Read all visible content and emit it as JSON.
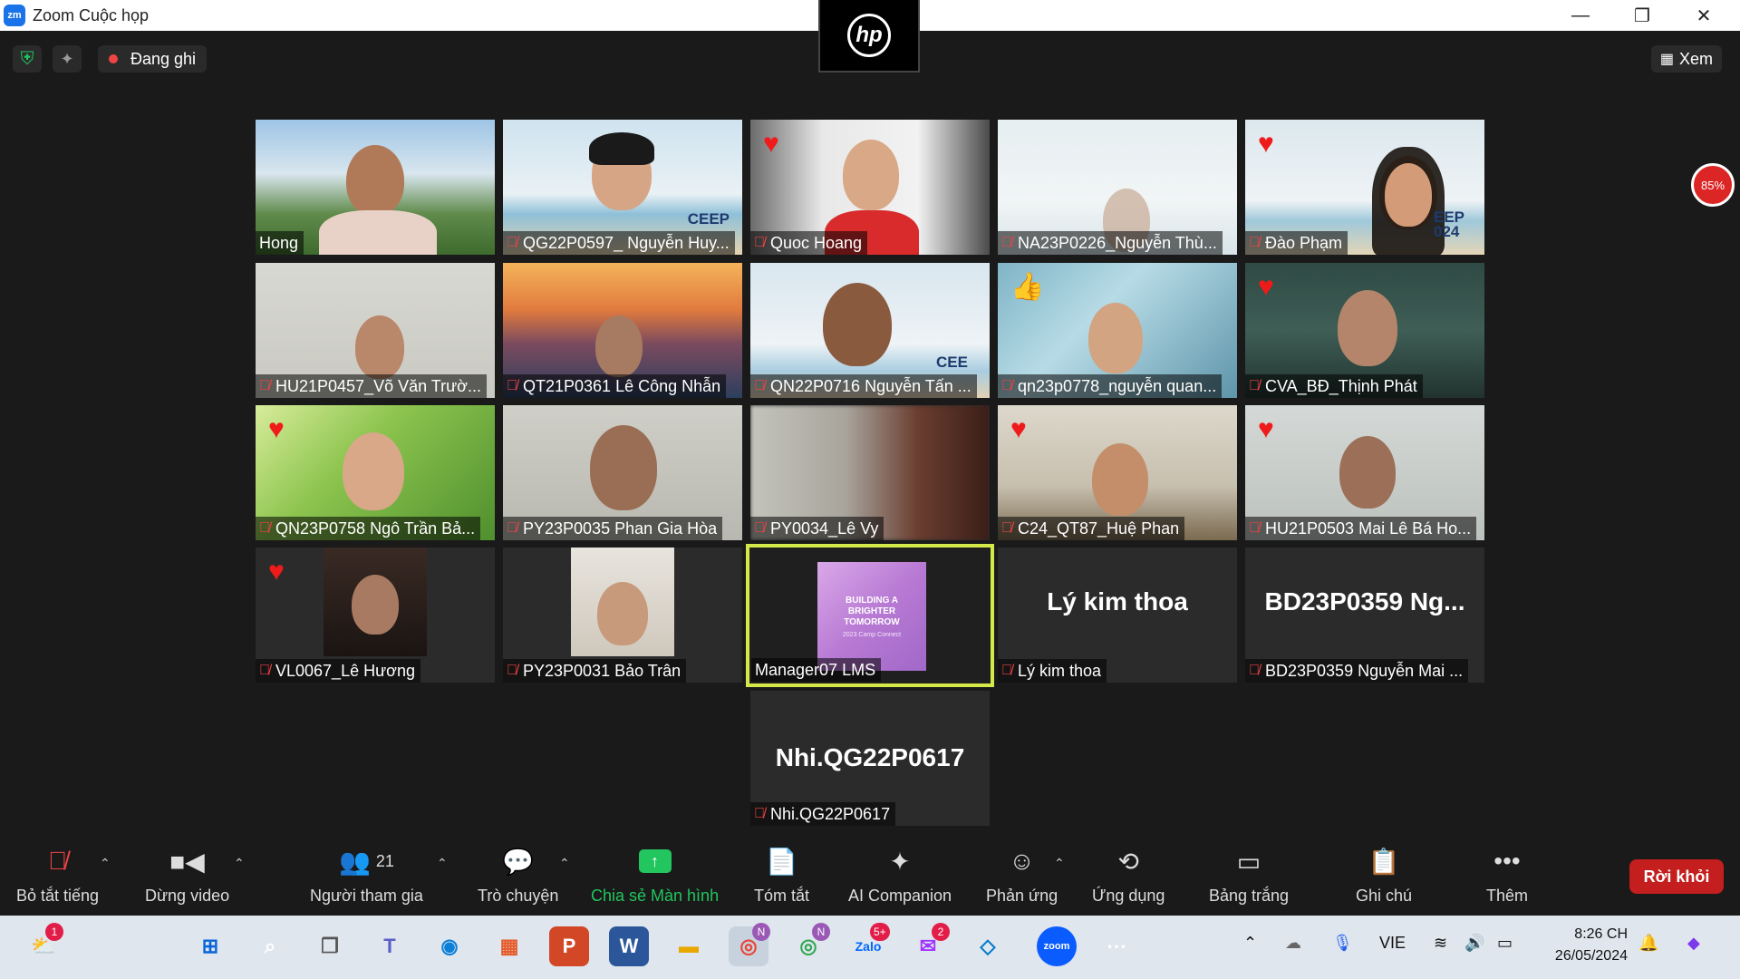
{
  "window": {
    "title": "Zoom Cuộc họp",
    "app_icon": "zm"
  },
  "topbar": {
    "recording_label": "Đang ghi",
    "view_label": "Xem",
    "cam_brand": "hp",
    "percent": "85%"
  },
  "tiles": [
    {
      "name": "Hong",
      "muted": false,
      "reaction": ""
    },
    {
      "name": "QG22P0597_ Nguyễn Huy...",
      "muted": true,
      "reaction": "",
      "overlay": "CEEP"
    },
    {
      "name": "Quoc Hoang",
      "muted": true,
      "reaction": "heart"
    },
    {
      "name": "NA23P0226_Nguyễn Thù...",
      "muted": true,
      "reaction": ""
    },
    {
      "name": "Đào Phạm",
      "muted": true,
      "reaction": "heart",
      "overlay": "EEP 024"
    },
    {
      "name": "HU21P0457_Võ Văn Trườ...",
      "muted": true,
      "reaction": ""
    },
    {
      "name": "QT21P0361 Lê Công Nhẫn",
      "muted": true,
      "reaction": ""
    },
    {
      "name": "QN22P0716 Nguyễn Tấn ...",
      "muted": true,
      "reaction": "",
      "overlay": "CEE"
    },
    {
      "name": "qn23p0778_nguyễn quan...",
      "muted": true,
      "reaction": "thumbs-up"
    },
    {
      "name": "CVA_BĐ_Thịnh Phát",
      "muted": true,
      "reaction": "heart"
    },
    {
      "name": "QN23P0758 Ngô Trần Bả...",
      "muted": true,
      "reaction": "heart"
    },
    {
      "name": "PY23P0035 Phan Gia Hòa",
      "muted": true,
      "reaction": ""
    },
    {
      "name": "PY0034_Lê Vy",
      "muted": true,
      "reaction": ""
    },
    {
      "name": "C24_QT87_Huệ Phan",
      "muted": true,
      "reaction": "heart"
    },
    {
      "name": "HU21P0503 Mai Lê Bá Ho...",
      "muted": true,
      "reaction": "heart"
    },
    {
      "name": "VL0067_Lê Hương",
      "muted": true,
      "reaction": "heart"
    },
    {
      "name": "PY23P0031 Bảo Trân",
      "muted": true,
      "reaction": ""
    },
    {
      "name": "Manager07 LMS",
      "muted": false,
      "reaction": "",
      "active": true,
      "slide_text": "BUILDING A BRIGHTER TOMORROW",
      "slide_sub": "2023 Camp Connect"
    },
    {
      "name": "Lý kim thoa",
      "muted": true,
      "reaction": "",
      "big_name": "Lý kim thoa"
    },
    {
      "name": "BD23P0359 Nguyễn Mai ...",
      "muted": true,
      "reaction": "",
      "big_name": "BD23P0359  Ng..."
    },
    {
      "name": "Nhi.QG22P0617",
      "muted": true,
      "reaction": "",
      "big_name": "Nhi.QG22P0617"
    }
  ],
  "toolbar": {
    "mute": "Bỏ tắt tiếng",
    "video": "Dừng video",
    "participants": "Người tham gia",
    "participants_count": "21",
    "chat": "Trò chuyện",
    "share": "Chia sẻ Màn hình",
    "summary": "Tóm tắt",
    "ai": "AI Companion",
    "reactions": "Phản ứng",
    "apps": "Ứng dụng",
    "whiteboard": "Bảng trắng",
    "notes": "Ghi chú",
    "more": "Thêm",
    "leave": "Rời khỏi"
  },
  "taskbar": {
    "weather_badge": "1",
    "chrome_badge": "N",
    "chrome2_badge": "N",
    "zalo_badge": "5+",
    "messenger_badge": "2",
    "lang": "VIE",
    "time": "8:26 CH",
    "date": "26/05/2024",
    "zoom_label": "zoom",
    "word_label": "W",
    "ppt_label": "P",
    "teams_label": "T",
    "zalo_label": "Zalo"
  },
  "colors": {
    "share_green": "#22c55e",
    "leave_red": "#c41e1e",
    "active_border": "#d4e84a",
    "muted_red": "#ef4444"
  }
}
